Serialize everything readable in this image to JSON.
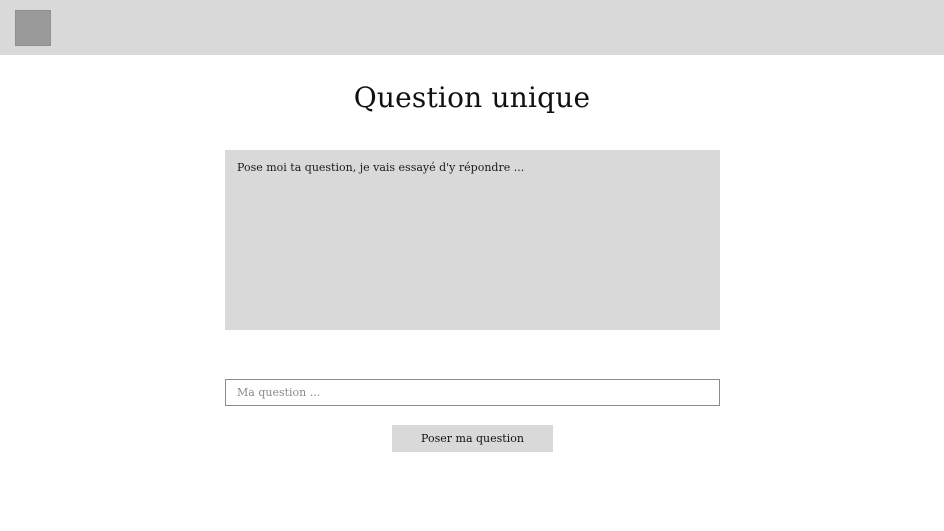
{
  "header": {
    "logo_icon": "logo-placeholder"
  },
  "main": {
    "title": "Question unique",
    "answer_text": "Pose moi ta question, je vais essayé d'y répondre ...",
    "question_input": {
      "value": "",
      "placeholder": "Ma question ..."
    },
    "submit_label": "Poser ma question"
  },
  "colors": {
    "topbar_bg": "#d9d9d9",
    "logo_bg": "#9a9a9a",
    "panel_bg": "#d9d9d9",
    "input_border": "#8a8a8a",
    "text": "#111111"
  }
}
